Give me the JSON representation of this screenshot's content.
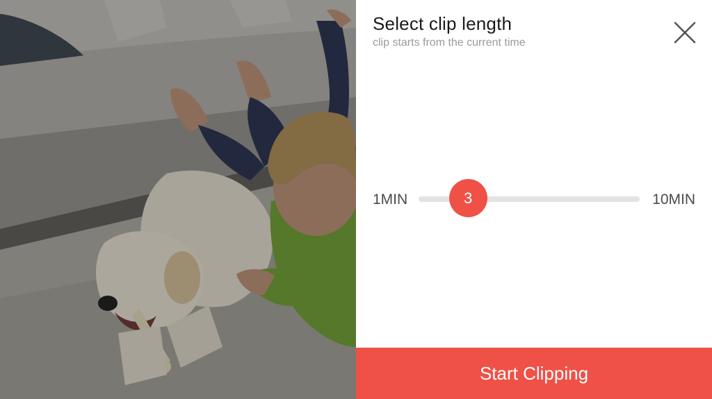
{
  "dialog": {
    "title": "Select clip length",
    "subtitle": "clip starts from the current time",
    "close_icon": "close-icon"
  },
  "slider": {
    "min_label": "1MIN",
    "max_label": "10MIN",
    "min": 1,
    "max": 10,
    "value": 3,
    "value_label": "3"
  },
  "actions": {
    "start_label": "Start Clipping"
  },
  "colors": {
    "accent": "#ef5147",
    "track": "#e3e3e3"
  },
  "feed": {
    "description_icon": "camera-feed-image"
  }
}
